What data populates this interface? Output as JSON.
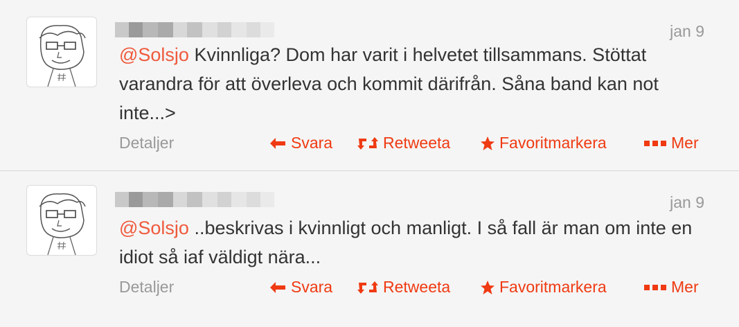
{
  "tweets": [
    {
      "mention": "@Solsjo",
      "body": " Kvinnliga? Dom har varit i helvetet tillsammans. Stöttat varandra för att överleva och kommit därifrån. Såna band kan not inte...>",
      "date": "jan 9",
      "details_label": "Detaljer",
      "actions": {
        "reply": "Svara",
        "retweet": "Retweeta",
        "favorite": "Favoritmarkera",
        "more": "Mer"
      }
    },
    {
      "mention": "@Solsjo",
      "body": " ..beskrivas i kvinnligt och manligt. I så fall är man om inte en idiot så iaf väldigt nära...",
      "date": "jan 9",
      "details_label": "Detaljer",
      "actions": {
        "reply": "Svara",
        "retweet": "Retweeta",
        "favorite": "Favoritmarkera",
        "more": "Mer"
      }
    }
  ],
  "colors": {
    "accent": "#ef3a12",
    "mention": "#ef5a3c",
    "muted": "#999999",
    "text": "#333333"
  },
  "icons": [
    "reply-arrow-icon",
    "retweet-icon",
    "star-icon",
    "more-dots-icon"
  ]
}
